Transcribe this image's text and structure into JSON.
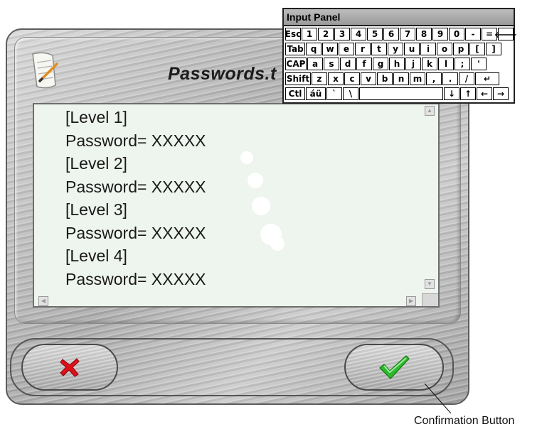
{
  "window": {
    "title": "Passwords.t",
    "icon": "document-pencil-icon"
  },
  "text_lines": [
    "[Level 1]",
    "Password= XXXXX",
    "[Level 2]",
    "Password= XXXXX",
    "[Level 3]",
    "Password= XXXXX",
    "[Level 4]",
    "Password= XXXXX"
  ],
  "scrollbar": {
    "up": "▲",
    "down": "▼",
    "left": "◀",
    "right": "▶"
  },
  "buttons": {
    "cancel_icon": "red-x-icon",
    "confirm_icon": "green-checkmark-icon"
  },
  "callout": {
    "label": "Confirmation Button"
  },
  "input_panel": {
    "title": "Input Panel",
    "rows": [
      [
        "Esc",
        "1",
        "2",
        "3",
        "4",
        "5",
        "6",
        "7",
        "8",
        "9",
        "0",
        "-",
        "=",
        "🡐"
      ],
      [
        "Tab",
        "q",
        "w",
        "e",
        "r",
        "t",
        "y",
        "u",
        "i",
        "o",
        "p",
        "[",
        "]"
      ],
      [
        "CAP",
        "a",
        "s",
        "d",
        "f",
        "g",
        "h",
        "j",
        "k",
        "l",
        ";",
        "'"
      ],
      [
        "Shift",
        "z",
        "x",
        "c",
        "v",
        "b",
        "n",
        "m",
        ",",
        ".",
        "/",
        "↵"
      ],
      [
        "Ctl",
        "áü",
        "`",
        "\\",
        " ",
        "↓",
        "↑",
        "←",
        "→"
      ]
    ]
  },
  "colors": {
    "cancel_x": "#e0101a",
    "confirm_check": "#2fb82f",
    "textarea_bg": "#eef4ee"
  }
}
